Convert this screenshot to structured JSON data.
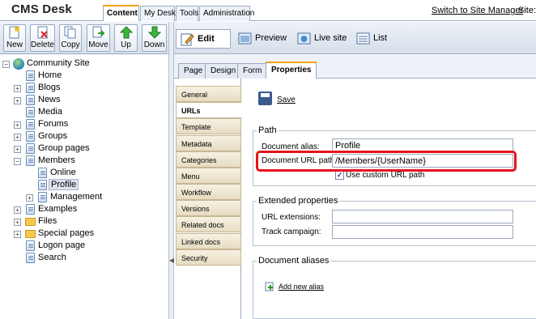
{
  "header": {
    "logo": "CMS Desk",
    "tabs": [
      "Content",
      "My Desk",
      "Tools",
      "Administration"
    ],
    "switch_link": "Switch to Site Manager",
    "site_label": "Site:"
  },
  "toolbar": {
    "new": "New",
    "delete": "Delete",
    "copy": "Copy",
    "move": "Move",
    "up": "Up",
    "down": "Down"
  },
  "tree": {
    "root": "Community Site",
    "home": "Home",
    "blogs": "Blogs",
    "news": "News",
    "media": "Media",
    "forums": "Forums",
    "groups": "Groups",
    "group_pages": "Group pages",
    "members": "Members",
    "online": "Online",
    "profile": "Profile",
    "management": "Management",
    "examples": "Examples",
    "files": "Files",
    "special_pages": "Special pages",
    "logon_page": "Logon page",
    "search": "Search"
  },
  "modes": {
    "edit": "Edit",
    "preview": "Preview",
    "live_site": "Live site",
    "list": "List"
  },
  "subtabs": [
    "Page",
    "Design",
    "Form",
    "Properties"
  ],
  "vtabs": [
    "General",
    "URLs",
    "Template",
    "Metadata",
    "Categories",
    "Menu",
    "Workflow",
    "Versions",
    "Related docs",
    "Linked docs",
    "Security"
  ],
  "content": {
    "save": "Save",
    "path_legend": "Path",
    "alias_label": "Document alias:",
    "alias_value": "Profile",
    "urlpath_label": "Document URL path:",
    "urlpath_value": "/Members/{UserName}",
    "use_custom_label": "Use custom URL path",
    "use_custom_checked": true,
    "ext_legend": "Extended properties",
    "url_ext_label": "URL extensions:",
    "url_ext_value": "",
    "track_label": "Track campaign:",
    "track_value": "",
    "aliases_legend": "Document aliases",
    "add_alias": "Add new alias"
  }
}
